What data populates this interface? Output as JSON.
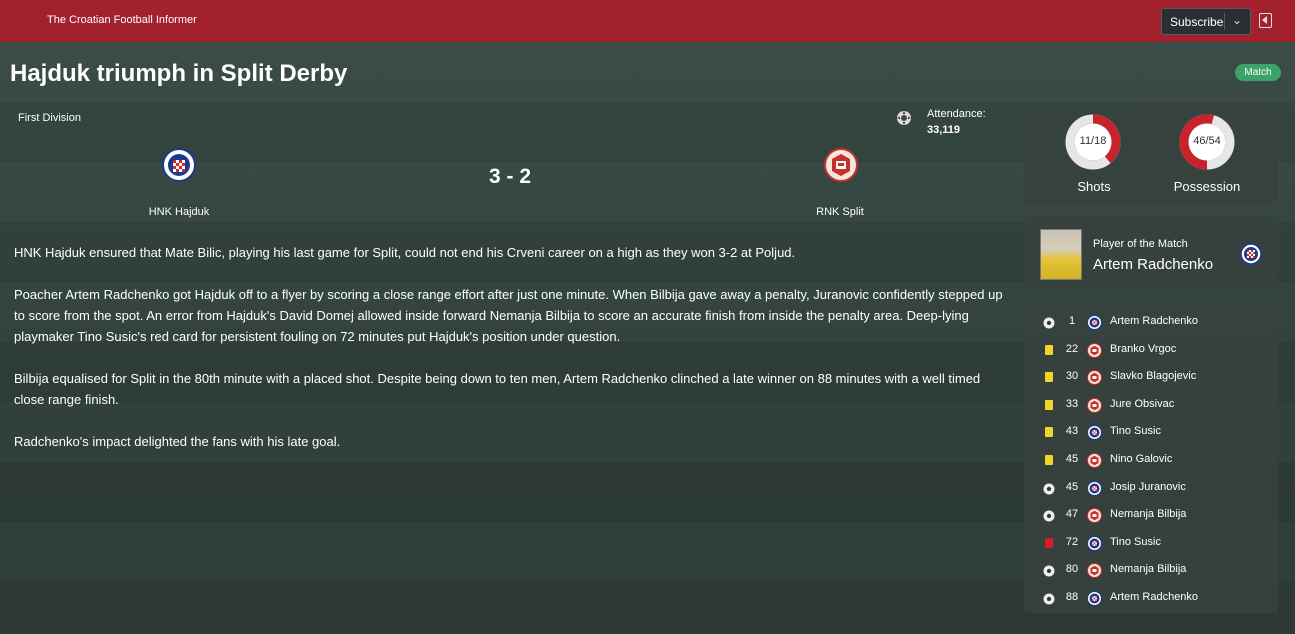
{
  "header": {
    "brand": "The Croatian Football Informer",
    "subscribe_label": "Subscribe",
    "accent": "#a3202d"
  },
  "article": {
    "headline": "Hajduk triumph in Split Derby",
    "tag": "Match",
    "paragraphs": [
      "HNK Hajduk ensured that Mate Bilic, playing his last game for Split, could not end his Crveni career on a high as they won 3-2 at Poljud.",
      "Poacher Artem Radchenko got Hajduk off to a flyer by scoring a close range effort after just one minute. When Bilbija gave away a penalty, Juranovic confidently stepped up to score from the spot. An error from Hajduk's David Domej allowed inside forward Nemanja Bilbija to score an accurate finish from inside the penalty area. Deep-lying playmaker Tino Susic's red card for persistent fouling on 72 minutes put Hajduk's position under question.",
      "Bilbija equalised for Split in the 80th minute with a placed shot. Despite being down to ten men, Artem Radchenko clinched a late winner on 88 minutes with a well timed close range finish.",
      "Radchenko's impact delighted the fans with his late goal."
    ]
  },
  "match": {
    "competition": "First Division",
    "attendance_label": "Attendance:",
    "attendance_value": "33,119",
    "home_team": "HNK Hajduk",
    "away_team": "RNK Split",
    "score": "3 - 2"
  },
  "stats": {
    "shots_value": "11/18",
    "shots_label": "Shots",
    "shots_fraction": 0.611,
    "possession_value": "46/54",
    "possession_label": "Possession",
    "possession_fraction": 0.46
  },
  "potm": {
    "label": "Player of the Match",
    "name": "Artem Radchenko"
  },
  "events": [
    {
      "type": "goal",
      "minute": "1",
      "team": "hajduk",
      "player": "Artem Radchenko"
    },
    {
      "type": "yellow",
      "minute": "22",
      "team": "split",
      "player": "Branko Vrgoc"
    },
    {
      "type": "yellow",
      "minute": "30",
      "team": "split",
      "player": "Slavko Blagojevic"
    },
    {
      "type": "yellow",
      "minute": "33",
      "team": "split",
      "player": "Jure Obsivac"
    },
    {
      "type": "yellow",
      "minute": "43",
      "team": "hajduk",
      "player": "Tino Susic"
    },
    {
      "type": "yellow",
      "minute": "45",
      "team": "split",
      "player": "Nino Galovic"
    },
    {
      "type": "goal",
      "minute": "45",
      "team": "hajduk",
      "player": "Josip Juranovic"
    },
    {
      "type": "goal",
      "minute": "47",
      "team": "split",
      "player": "Nemanja Bilbija"
    },
    {
      "type": "red",
      "minute": "72",
      "team": "hajduk",
      "player": "Tino Susic"
    },
    {
      "type": "goal",
      "minute": "80",
      "team": "split",
      "player": "Nemanja Bilbija"
    },
    {
      "type": "goal",
      "minute": "88",
      "team": "hajduk",
      "player": "Artem Radchenko"
    }
  ],
  "icons": {
    "ball": "football-icon",
    "yellow": "yellow-card-icon",
    "red": "red-card-icon",
    "hajduk": "hajduk-crest-icon",
    "split": "split-crest-icon"
  }
}
